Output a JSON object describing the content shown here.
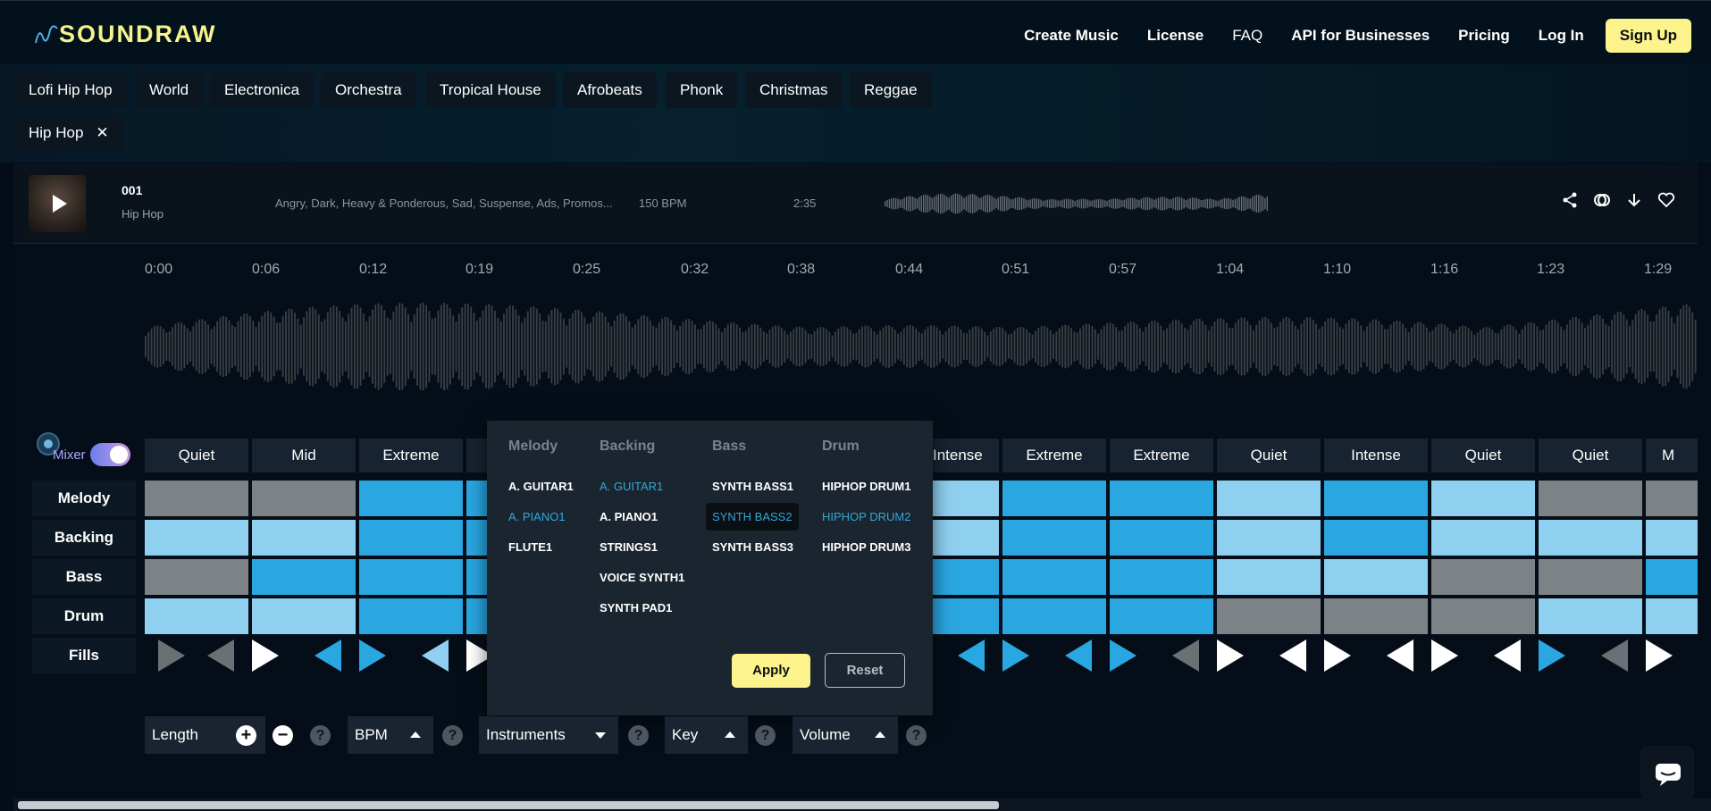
{
  "header": {
    "logo_text": "SOUNDRAW",
    "nav": [
      "Create Music",
      "License",
      "FAQ",
      "API for Businesses",
      "Pricing",
      "Log In"
    ],
    "signup": "Sign Up"
  },
  "genres": [
    "Lofi Hip Hop",
    "World",
    "Electronica",
    "Orchestra",
    "Tropical House",
    "Afrobeats",
    "Phonk",
    "Christmas",
    "Reggae"
  ],
  "selected_genre": {
    "label": "Hip Hop",
    "remove": "✕"
  },
  "track": {
    "id": "001",
    "genre": "Hip Hop",
    "tags": "Angry, Dark, Heavy & Ponderous, Sad, Suspense, Ads, Promos...",
    "bpm": "150 BPM",
    "duration": "2:35"
  },
  "timeline": [
    "0:00",
    "0:06",
    "0:12",
    "0:19",
    "0:25",
    "0:32",
    "0:38",
    "0:44",
    "0:51",
    "0:57",
    "1:04",
    "1:10",
    "1:16",
    "1:23",
    "1:29"
  ],
  "mixer": {
    "label": "Mixer",
    "enabled": true
  },
  "row_labels": {
    "melody": "Melody",
    "backing": "Backing",
    "bass": "Bass",
    "drum": "Drum",
    "fills": "Fills"
  },
  "energy": [
    "Quiet",
    "Mid",
    "Extreme",
    "",
    "",
    "",
    "",
    "Intense",
    "Extreme",
    "Extreme",
    "Quiet",
    "Intense",
    "Quiet",
    "Quiet",
    "M"
  ],
  "instruments": {
    "melody": {
      "title": "Melody",
      "items": [
        "A. GUITAR1",
        "A. PIANO1",
        "FLUTE1"
      ]
    },
    "backing": {
      "title": "Backing",
      "items": [
        "A. GUITAR1",
        "A. PIANO1",
        "STRINGS1",
        "VOICE SYNTH1",
        "SYNTH PAD1"
      ]
    },
    "bass": {
      "title": "Bass",
      "items": [
        "SYNTH BASS1",
        "SYNTH BASS2",
        "SYNTH BASS3"
      ]
    },
    "drum": {
      "title": "Drum",
      "items": [
        "HIPHOP DRUM1",
        "HIPHOP DRUM2",
        "HIPHOP DRUM3"
      ]
    },
    "apply": "Apply",
    "reset": "Reset"
  },
  "controls": {
    "length": "Length",
    "bpm": "BPM",
    "instruments": "Instruments",
    "key": "Key",
    "volume": "Volume",
    "help": "?",
    "plus": "+",
    "minus": "−"
  },
  "colors": {
    "accent": "#fdf38c",
    "blue": "#2aa6e1",
    "light_blue": "#8fd0f0",
    "gray": "#7d8287",
    "purple": "#a7a9ff"
  }
}
